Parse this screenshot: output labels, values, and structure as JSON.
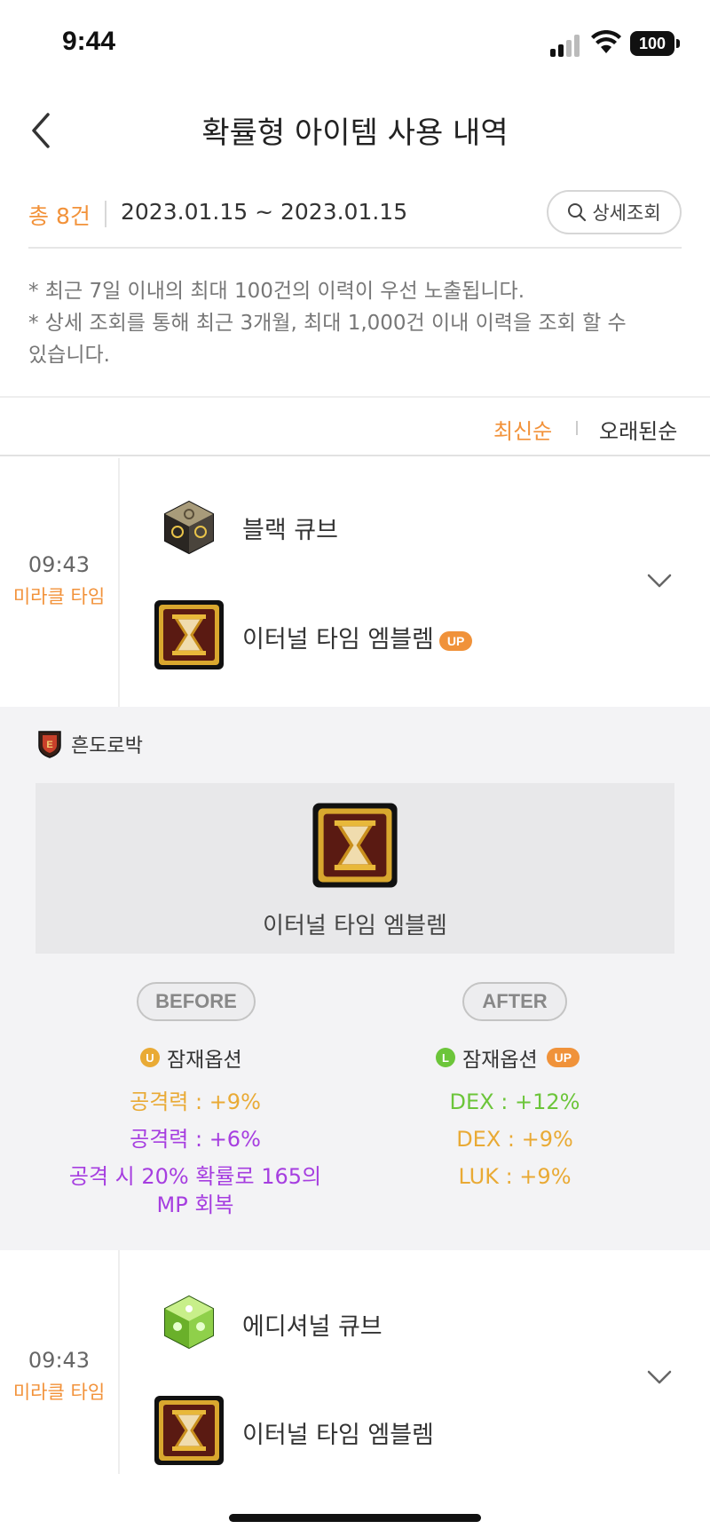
{
  "status_bar": {
    "time": "9:44",
    "battery": "100"
  },
  "header": {
    "title": "확률형 아이템 사용 내역"
  },
  "summary": {
    "total": "총 8건",
    "date_range": "2023.01.15 ~ 2023.01.15",
    "detail_button": "상세조회"
  },
  "notes": [
    "* 최근 7일 이내의 최대 100건의 이력이 우선 노출됩니다.",
    "* 상세 조회를 통해 최근 3개월, 최대 1,000건 이내 이력을 조회 할 수",
    "있습니다."
  ],
  "sort": {
    "newest": "최신순",
    "oldest": "오래된순"
  },
  "records": [
    {
      "time": "09:43",
      "tag": "미라클 타임",
      "cube": "블랙 큐브",
      "target": "이터널 타임 엠블렘",
      "target_badge": "UP",
      "expanded": true
    },
    {
      "time": "09:43",
      "tag": "미라클 타임",
      "cube": "에디셔널 큐브",
      "target": "이터널 타임 엠블렘",
      "expanded": false
    }
  ],
  "detail": {
    "character": "흔도로박",
    "item_name": "이터널 타임 엠블렘",
    "before": {
      "label": "BEFORE",
      "grade_letter": "U",
      "option_label": "잠재옵션",
      "options": [
        "공격력 : +9%",
        "공격력 : +6%",
        "공격 시 20% 확률로 165의 MP 회복"
      ]
    },
    "after": {
      "label": "AFTER",
      "grade_letter": "L",
      "option_label": "잠재옵션",
      "badge": "UP",
      "options": [
        "DEX : +12%",
        "DEX : +9%",
        "LUK : +9%"
      ]
    }
  },
  "colors": {
    "accent": "#f2923a",
    "unique": "#e9aa35",
    "epic": "#a63ee0",
    "legendary": "#6cc53a"
  }
}
